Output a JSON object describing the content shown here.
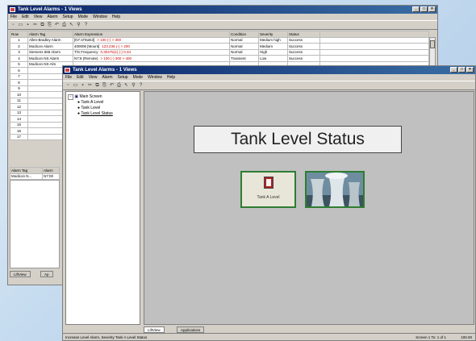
{
  "back_window": {
    "title": "Tank Level Alarms - 1 Views",
    "menu": [
      "File",
      "Edit",
      "View",
      "Alarm",
      "Setup",
      "Mode",
      "Window",
      "Help"
    ],
    "columns": [
      "Row",
      "Alarm Tag",
      "Alarm Expression",
      "Condition",
      "Severity",
      "Status"
    ],
    "rows": [
      {
        "row": "1",
        "tag": "Allen-Bradley Alarm",
        "expr": "[N7:4/Tank3]",
        "expr_val": "> 100 (-) > 300",
        "condition": "Normal",
        "severity": "Medium high",
        "status": "Success"
      },
      {
        "row": "2",
        "tag": "Modicon Alarm",
        "expr": "400006 [Mount]",
        "expr_val": "123.236 (-) > 200",
        "condition": "Normal",
        "severity": "Medium",
        "status": "Success"
      },
      {
        "row": "3",
        "tag": "Siemens 565 Alarm",
        "expr": "T/S Frequency",
        "expr_val": "0.30475(1) (-) 0.34",
        "condition": "Normal",
        "severity": "High",
        "status": "Success"
      },
      {
        "row": "4",
        "tag": "Modicon NS Alarm",
        "expr": "N7:8 (Remote)",
        "expr_val": "> 100 (-) 300 > 400",
        "condition": "Transient",
        "severity": "Low",
        "status": "Success"
      },
      {
        "row": "5",
        "tag": "Modicon NS Alm",
        "expr": "",
        "expr_val": "",
        "condition": "",
        "severity": "",
        "status": ""
      },
      {
        "row": "6",
        "tag": "",
        "expr": "",
        "expr_val": "",
        "condition": "",
        "severity": "",
        "status": ""
      },
      {
        "row": "7",
        "tag": "",
        "expr": "",
        "expr_val": "",
        "condition": "",
        "severity": "",
        "status": ""
      },
      {
        "row": "8",
        "tag": "",
        "expr": "",
        "expr_val": "",
        "condition": "",
        "severity": "",
        "status": ""
      },
      {
        "row": "9",
        "tag": "",
        "expr": "",
        "expr_val": "",
        "condition": "",
        "severity": "",
        "status": ""
      },
      {
        "row": "10",
        "tag": "",
        "expr": "",
        "expr_val": "",
        "condition": "",
        "severity": "",
        "status": ""
      },
      {
        "row": "11",
        "tag": "",
        "expr": "",
        "expr_val": "",
        "condition": "",
        "severity": "",
        "status": ""
      },
      {
        "row": "12",
        "tag": "",
        "expr": "",
        "expr_val": "",
        "condition": "",
        "severity": "",
        "status": ""
      },
      {
        "row": "13",
        "tag": "",
        "expr": "",
        "expr_val": "",
        "condition": "",
        "severity": "",
        "status": ""
      },
      {
        "row": "14",
        "tag": "",
        "expr": "",
        "expr_val": "",
        "condition": "",
        "severity": "",
        "status": ""
      },
      {
        "row": "15",
        "tag": "",
        "expr": "",
        "expr_val": "",
        "condition": "",
        "severity": "",
        "status": ""
      },
      {
        "row": "16",
        "tag": "",
        "expr": "",
        "expr_val": "",
        "condition": "",
        "severity": "",
        "status": ""
      },
      {
        "row": "17",
        "tag": "",
        "expr": "",
        "expr_val": "",
        "condition": "",
        "severity": "",
        "status": ""
      }
    ],
    "lower_columns": [
      "Alarm Tag",
      "Alarm"
    ],
    "lower_rows": [
      {
        "tag": "Modicon N...",
        "val": "N7:00"
      }
    ],
    "tabs": [
      "LiftView",
      "Ap"
    ]
  },
  "front_window": {
    "title": "Tank Level Alarms - 1 Views",
    "menu": [
      "File",
      "Edit",
      "View",
      "Alarm",
      "Setup",
      "Mode",
      "Window",
      "Help"
    ],
    "tree": {
      "root": "Main Screen",
      "children": [
        "Tank A Level",
        "Tank Level",
        "Tank Level Status"
      ]
    },
    "screen": {
      "title": "Tank Level Status",
      "tank_button_label": "Tank A Level"
    },
    "tabs": [
      "LiftView",
      "Applications"
    ],
    "status_left": "Increase Level Alarm, Severity Tank A Level Status",
    "status_right_1": "Screen 1 To: 1 of 1",
    "status_right_2": "100.00"
  },
  "colors": {
    "titlebar": "#0a246a",
    "window_face": "#d4d0c8",
    "button_border": "#2e7d32",
    "alarm_red": "#c00000"
  }
}
